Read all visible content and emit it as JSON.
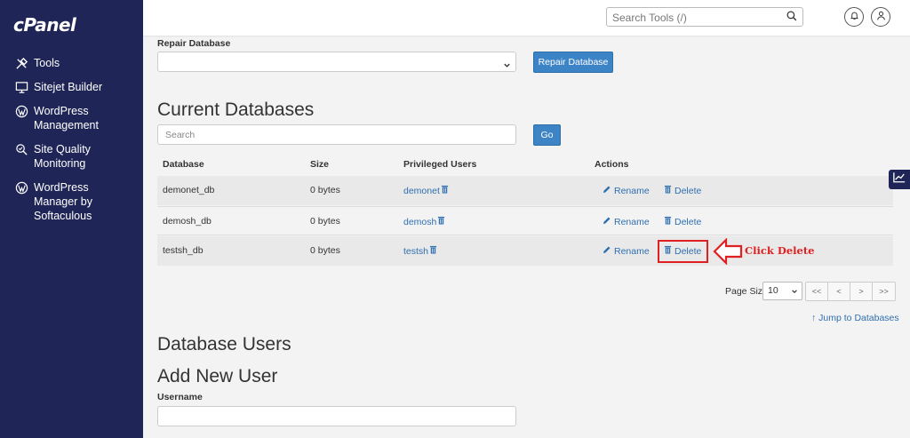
{
  "sidebar": {
    "logo": "cPanel",
    "items": [
      {
        "label": "Tools",
        "icon": "tools-icon"
      },
      {
        "label": "Sitejet Builder",
        "icon": "monitor-icon"
      },
      {
        "label": "WordPress\nManagement",
        "icon": "wordpress-icon"
      },
      {
        "label": "Site Quality\nMonitoring",
        "icon": "search-quality-icon"
      },
      {
        "label": "WordPress\nManager by\nSoftaculous",
        "icon": "wordpress-icon"
      }
    ]
  },
  "header": {
    "search_placeholder": "Search Tools (/)"
  },
  "repair": {
    "label": "Repair Database",
    "select_value": "",
    "button": "Repair Database"
  },
  "current_databases": {
    "title": "Current Databases",
    "search_placeholder": "Search",
    "go_button": "Go",
    "columns": [
      "Database",
      "Size",
      "Privileged Users",
      "Actions"
    ],
    "rows": [
      {
        "database": "demonet_db",
        "size": "0 bytes",
        "user": "demonet"
      },
      {
        "database": "demosh_db",
        "size": "0 bytes",
        "user": "demosh"
      },
      {
        "database": "testsh_db",
        "size": "0 bytes",
        "user": "testsh"
      }
    ],
    "rename_label": "Rename",
    "delete_label": "Delete"
  },
  "annotation": {
    "text": "Click Delete",
    "color": "#e02020"
  },
  "pager": {
    "label": "Page Size",
    "value": "10",
    "buttons": [
      "<<",
      "<",
      ">",
      ">>"
    ]
  },
  "jump_link": "Jump to Databases",
  "database_users": {
    "title": "Database Users",
    "add_title": "Add New User",
    "username_label": "Username",
    "username_value": ""
  },
  "colors": {
    "sidebar_bg": "#1f2657",
    "primary": "#3d84c6",
    "link": "#2f6fb0"
  }
}
